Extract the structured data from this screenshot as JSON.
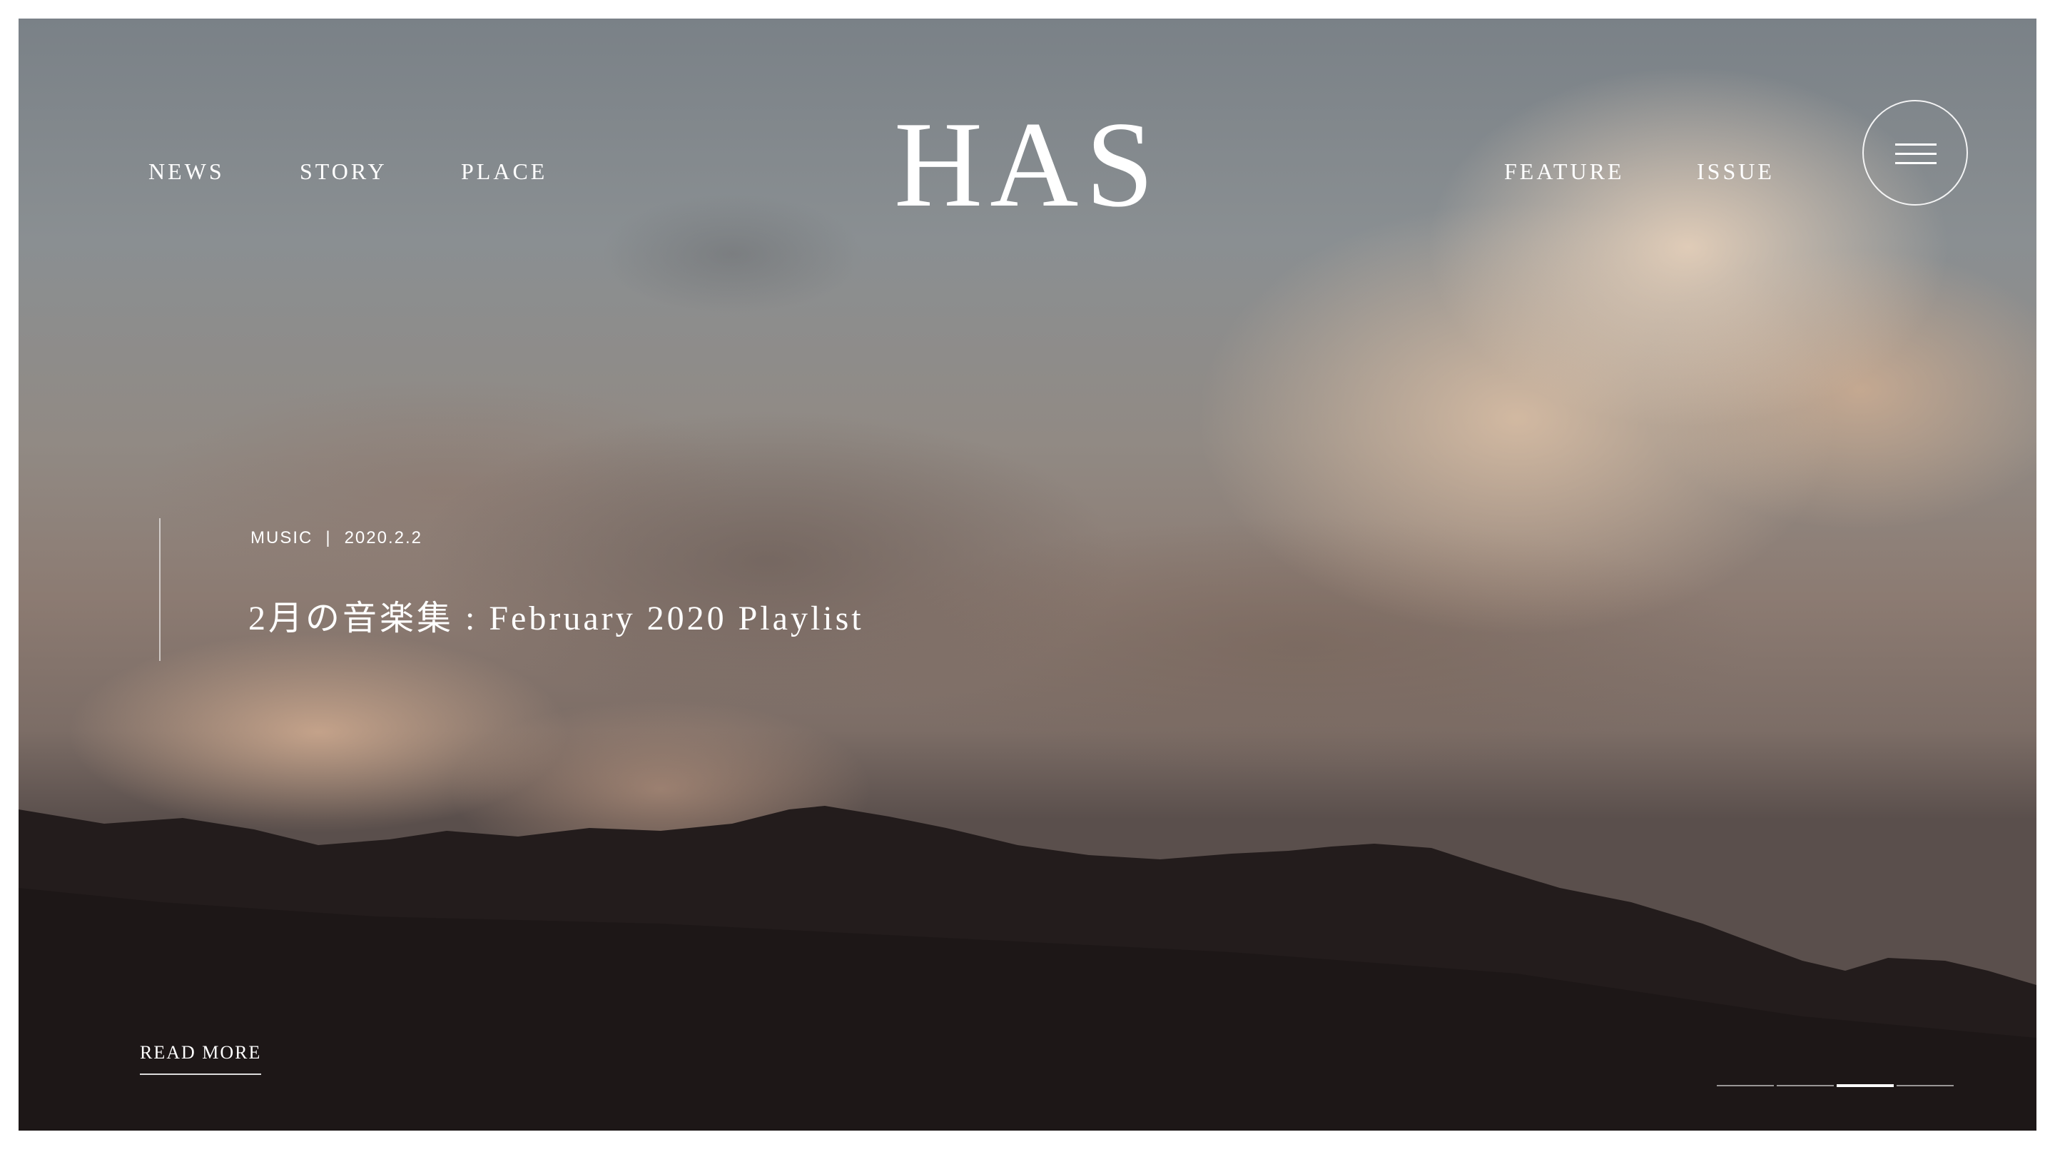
{
  "header": {
    "logo": "HAS",
    "nav_left": [
      "NEWS",
      "STORY",
      "PLACE"
    ],
    "nav_right": [
      "FEATURE",
      "ISSUE"
    ],
    "menu_icon": "hamburger-icon"
  },
  "hero": {
    "category": "MUSIC",
    "separator": "|",
    "date": "2020.2.2",
    "title": "2月の音楽集 : February 2020 Playlist",
    "read_more": "READ MORE",
    "slide_count": 4,
    "active_slide": 3
  }
}
